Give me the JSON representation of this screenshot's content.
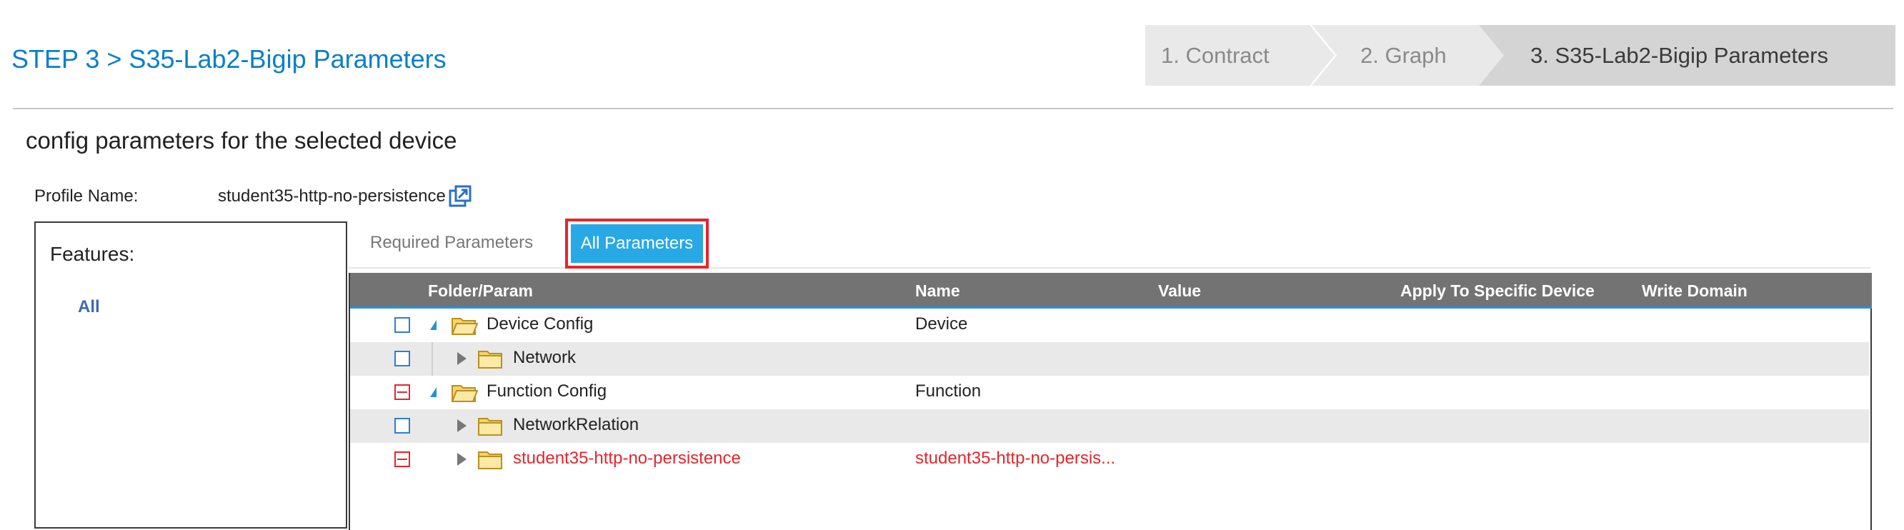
{
  "header": {
    "step_title": "STEP 3 > S35-Lab2-Bigip Parameters",
    "steps": [
      "1. Contract",
      "2. Graph",
      "3. S35-Lab2-Bigip Parameters"
    ]
  },
  "section_title": "config parameters for the selected device",
  "profile": {
    "label": "Profile Name:",
    "value": "student35-http-no-persistence"
  },
  "features": {
    "title": "Features:",
    "items": [
      "All"
    ]
  },
  "tabs": {
    "required": "Required Parameters",
    "all": "All Parameters"
  },
  "grid": {
    "columns": [
      "Folder/Param",
      "Name",
      "Value",
      "Apply To Specific Device",
      "Write Domain"
    ],
    "rows": [
      {
        "folder": "Device Config",
        "name": "Device",
        "expanded": true,
        "checkbox": "empty"
      },
      {
        "folder": "Network",
        "name": "",
        "expanded": false,
        "checkbox": "empty"
      },
      {
        "folder": "Function Config",
        "name": "Function",
        "expanded": true,
        "checkbox": "partial-red"
      },
      {
        "folder": "NetworkRelation",
        "name": "",
        "expanded": false,
        "checkbox": "empty"
      },
      {
        "folder": "student35-http-no-persistence",
        "name": "student35-http-no-persis...",
        "expanded": false,
        "checkbox": "partial-red"
      }
    ]
  },
  "colors": {
    "link_blue": "#0a7fc8",
    "active_tab": "#29a8e6",
    "highlight_border": "#e3262d",
    "grid_header": "#737373",
    "error_text": "#e3262d"
  },
  "icons": [
    "open-profile-icon",
    "folder-icon",
    "expand-triangle-icon",
    "collapse-triangle-icon",
    "checkbox-icon"
  ]
}
